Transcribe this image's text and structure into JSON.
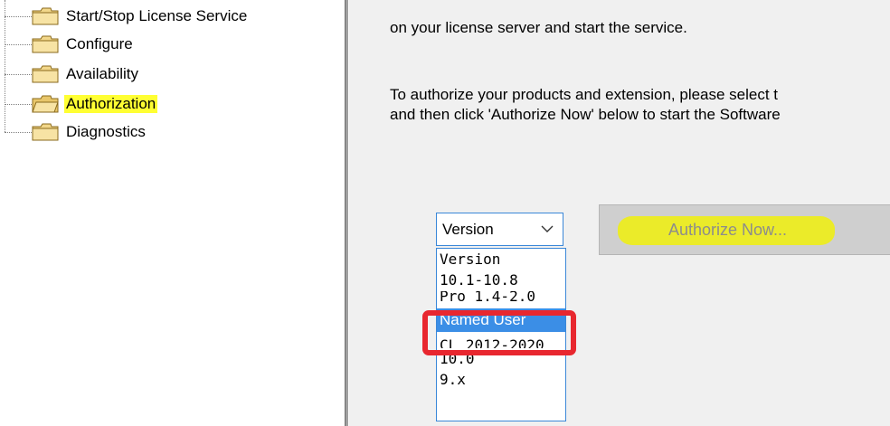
{
  "tree": {
    "items": [
      {
        "label": "Start/Stop License Service"
      },
      {
        "label": "Configure"
      },
      {
        "label": "Availability"
      },
      {
        "label": "Authorization"
      },
      {
        "label": "Diagnostics"
      }
    ],
    "selected_index": 3
  },
  "content": {
    "line1": "on your license server and start the service.",
    "line2": "To authorize your products and extension, please select t",
    "line3": "and then click 'Authorize Now' below to start the Software"
  },
  "version_select": {
    "value": "Version",
    "options": [
      "Version",
      "10.1-10.8",
      "Pro 1.4-2.0",
      "Named User",
      "CL 2012-2020",
      "10.0",
      "9.x"
    ],
    "highlighted": "Named User"
  },
  "authorize_button": {
    "label": "Authorize Now..."
  },
  "colors": {
    "selection_highlight": "#ffff33",
    "annotation_red": "#e8272f",
    "option_selected": "#3b8ee6"
  }
}
